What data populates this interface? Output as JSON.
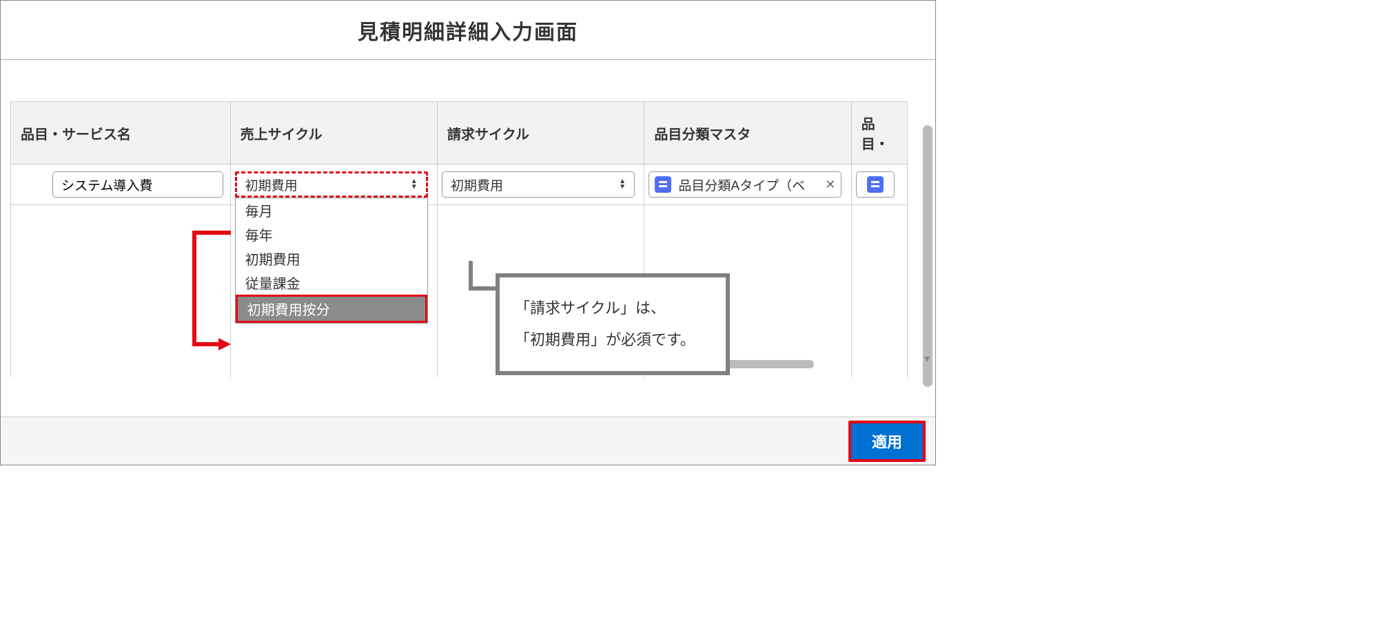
{
  "header": {
    "title": "見積明細詳細入力画面"
  },
  "columns": {
    "c1": "品目・サービス名",
    "c2": "売上サイクル",
    "c3": "請求サイクル",
    "c4": "品目分類マスタ",
    "c5": "品目・"
  },
  "row": {
    "service_name": "システム導入費",
    "sales_cycle_selected": "初期費用",
    "billing_cycle_selected": "初期費用",
    "item_class_lookup": "品目分類Aタイプ（ベ"
  },
  "sales_cycle_options": {
    "o1": "毎月",
    "o2": "毎年",
    "o3": "初期費用",
    "o4": "従量課金",
    "o5": "初期費用按分"
  },
  "callout": {
    "line1": "「請求サイクル」は、",
    "line2": "「初期費用」が必須です。"
  },
  "footer": {
    "apply": "適用"
  }
}
